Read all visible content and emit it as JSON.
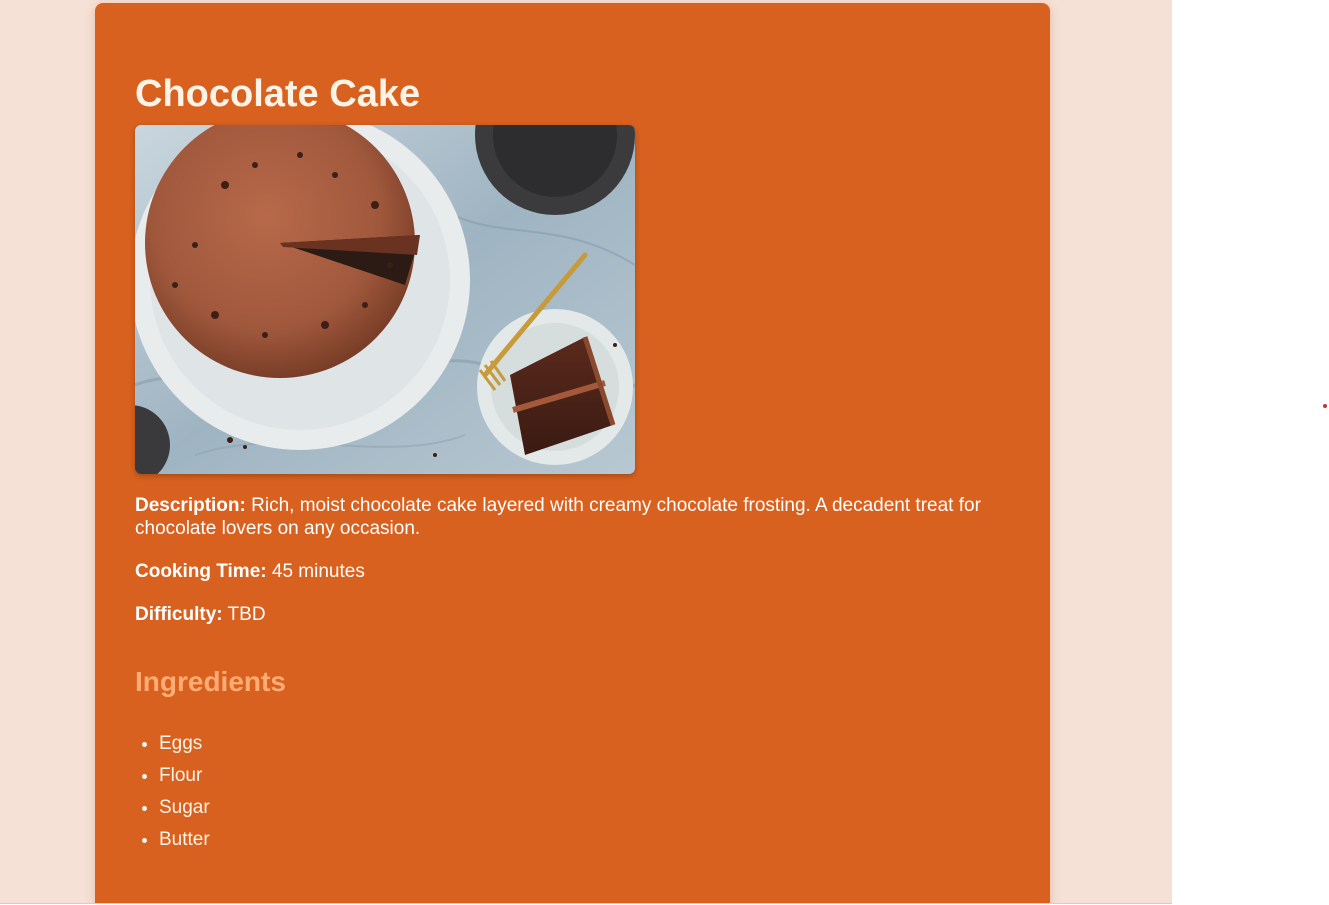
{
  "recipe": {
    "title": "Chocolate Cake",
    "image_alt": "Chocolate cake on a white plate with a slice on a side plate",
    "description_label": "Description:",
    "description_text": " Rich, moist chocolate cake layered with creamy chocolate frosting. A decadent treat for chocolate lovers on any occasion.",
    "cooking_time_label": "Cooking Time:",
    "cooking_time_value": " 45 minutes",
    "difficulty_label": "Difficulty:",
    "difficulty_value": " TBD",
    "ingredients_heading": "Ingredients",
    "ingredients": [
      "Eggs",
      "Flour",
      "Sugar",
      "Butter"
    ]
  },
  "colors": {
    "page_background": "#f6e1d6",
    "card_background": "#d9611f",
    "title_color": "#fdf3e6",
    "ingredients_heading_color": "#ffac75"
  }
}
